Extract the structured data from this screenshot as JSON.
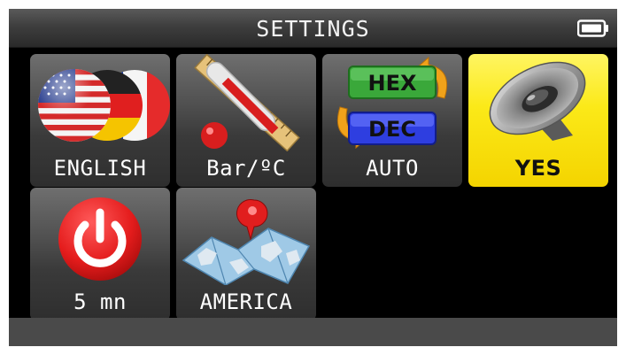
{
  "header": {
    "title": "SETTINGS",
    "battery_icon": "battery-full-icon"
  },
  "tiles": [
    {
      "label": "ENGLISH",
      "icon": "language-flags-icon",
      "selected": false
    },
    {
      "label": "Bar/ºC",
      "icon": "units-ruler-thermometer-icon",
      "selected": false
    },
    {
      "label": "AUTO",
      "icon": "hex-dec-convert-icon",
      "selected": false
    },
    {
      "label": "YES",
      "icon": "speaker-icon",
      "selected": true
    },
    {
      "label": "5 mn",
      "icon": "power-icon",
      "selected": false
    },
    {
      "label": "AMERICA",
      "icon": "map-pin-icon",
      "selected": false
    }
  ],
  "art_text": {
    "hex": "HEX",
    "dec": "DEC"
  },
  "colors": {
    "selected_tile": "#f9e31a",
    "tile": "#4a4a4a",
    "background": "#000000"
  }
}
